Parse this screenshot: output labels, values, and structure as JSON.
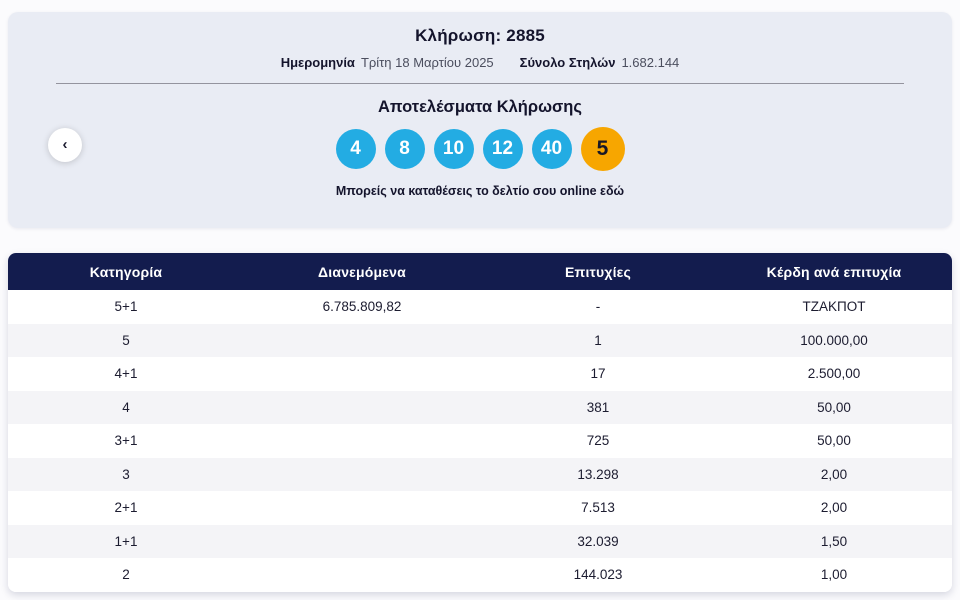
{
  "draw": {
    "title_label": "Κλήρωση:",
    "title_number": "2885",
    "date_label": "Ημερομηνία",
    "date_value": "Τρίτη 18 Μαρτίου 2025",
    "columns_label": "Σύνολο Στηλών",
    "columns_value": "1.682.144"
  },
  "results": {
    "heading": "Αποτελέσματα Κλήρωσης",
    "numbers": [
      "4",
      "8",
      "10",
      "12",
      "40"
    ],
    "bonus_number": "5",
    "cta_text": "Μπορείς να καταθέσεις το δελτίο σου online",
    "cta_link_label": "εδώ"
  },
  "nav": {
    "prev_icon": "‹"
  },
  "table": {
    "headers": [
      "Κατηγορία",
      "Διανεμόμενα",
      "Επιτυχίες",
      "Κέρδη ανά επιτυχία"
    ],
    "rows": [
      [
        "5+1",
        "6.785.809,82",
        "-",
        "ΤΖΑΚΠΟΤ"
      ],
      [
        "5",
        "",
        "1",
        "100.000,00"
      ],
      [
        "4+1",
        "",
        "17",
        "2.500,00"
      ],
      [
        "4",
        "",
        "381",
        "50,00"
      ],
      [
        "3+1",
        "",
        "725",
        "50,00"
      ],
      [
        "3",
        "",
        "13.298",
        "2,00"
      ],
      [
        "2+1",
        "",
        "7.513",
        "2,00"
      ],
      [
        "1+1",
        "",
        "32.039",
        "1,50"
      ],
      [
        "2",
        "",
        "144.023",
        "1,00"
      ]
    ]
  },
  "colors": {
    "ball_blue": "#23ace3",
    "ball_orange": "#f7a600",
    "header_navy": "#131c4e",
    "card_bg": "#e9ecf4",
    "alt_row": "#f4f4f7"
  }
}
